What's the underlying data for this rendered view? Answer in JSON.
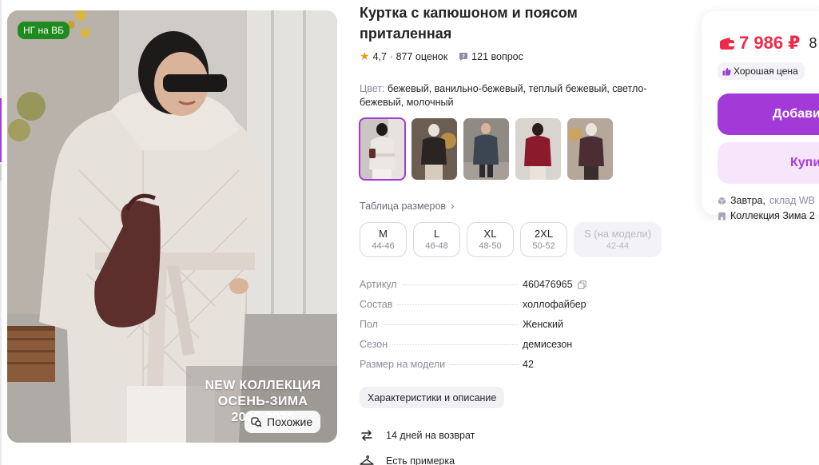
{
  "product": {
    "title": "Куртка с капюшоном и поясом приталенная",
    "rating": "4,7",
    "reviews": "· 877 оценок",
    "questions": "121 вопрос"
  },
  "photo": {
    "badge": "НГ на ВБ",
    "promo_line1": "NEW КОЛЛЕКЦИЯ",
    "promo_line2": "ОСЕНЬ-ЗИМА",
    "promo_line3": "2025-2026",
    "similar_label": "Похожие"
  },
  "color": {
    "label": "Цвет:",
    "value": "бежевый, ванильно-бежевый, теплый бежевый, светло-бежевый, молочный"
  },
  "thumbnails": [
    {
      "color": "#e9e4df",
      "selected": true
    },
    {
      "color": "#2a2523",
      "selected": false
    },
    {
      "color": "#3c4652",
      "selected": false
    },
    {
      "color": "#8a1a2c",
      "selected": false
    },
    {
      "color": "#4a2e33",
      "selected": false
    }
  ],
  "sizes": {
    "table_link": "Таблица размеров",
    "chips": [
      {
        "size": "M",
        "range": "44-46",
        "available": true
      },
      {
        "size": "L",
        "range": "46-48",
        "available": true
      },
      {
        "size": "XL",
        "range": "48-50",
        "available": true
      },
      {
        "size": "2XL",
        "range": "50-52",
        "available": true
      },
      {
        "size": "S (на модели)",
        "range": "42-44",
        "available": false
      }
    ]
  },
  "specs": [
    {
      "key": "Артикул",
      "value": "460476965",
      "copy": true
    },
    {
      "key": "Состав",
      "value": "холлофайбер"
    },
    {
      "key": "Пол",
      "value": "Женский"
    },
    {
      "key": "Сезон",
      "value": "демисезон"
    },
    {
      "key": "Размер на модели",
      "value": "42"
    }
  ],
  "characteristics_button": "Характеристики и описание",
  "return_info": "14 дней на возврат",
  "fitting_info": "Есть примерка",
  "price_card": {
    "price": "7 986 ₽",
    "old_price": "8",
    "good_price": "Хорошая цена",
    "add_button": "Добави",
    "buy_button": "Купи",
    "delivery_day": "Завтра,",
    "delivery_place": "склад WB",
    "collection": "Коллекция Зима 2"
  },
  "colors": {
    "accent": "#a33ad8",
    "price": "#f0284a",
    "badge_green": "#1f8a1f",
    "star": "#f09b16"
  }
}
